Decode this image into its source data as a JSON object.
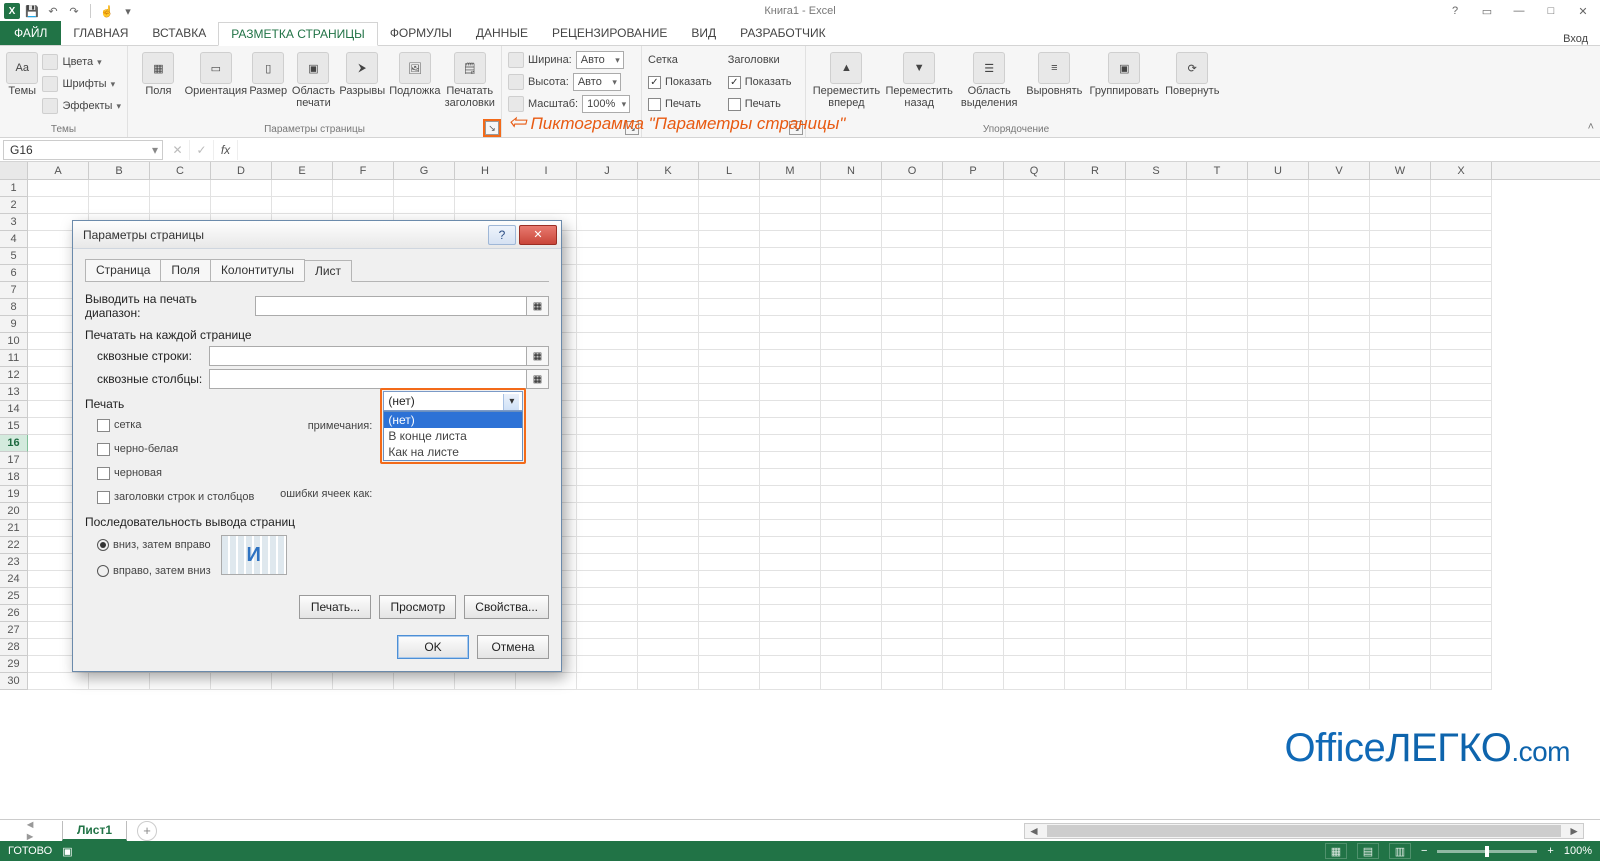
{
  "titlebar": {
    "app_initial": "X",
    "title": "Книга1 - Excel",
    "signin": "Вход",
    "help_window": "?",
    "ribbon_hide": "▭",
    "minimize": "—",
    "maximize": "□",
    "close": "✕"
  },
  "ribbon_tabs": {
    "file": "ФАЙЛ",
    "home": "ГЛАВНАЯ",
    "insert": "ВСТАВКА",
    "page_layout": "РАЗМЕТКА СТРАНИЦЫ",
    "formulas": "ФОРМУЛЫ",
    "data": "ДАННЫЕ",
    "review": "РЕЦЕНЗИРОВАНИЕ",
    "view": "ВИД",
    "developer": "РАЗРАБОТЧИК"
  },
  "ribbon": {
    "themes": {
      "themes_btn": "Темы",
      "colors": "Цвета",
      "fonts": "Шрифты",
      "effects": "Эффекты",
      "group_label": "Темы"
    },
    "page_setup": {
      "margins": "Поля",
      "orientation": "Ориентация",
      "size": "Размер",
      "print_area": "Область печати",
      "breaks": "Разрывы",
      "background": "Подложка",
      "print_titles": "Печатать заголовки",
      "group_label": "Параметры страницы"
    },
    "scale": {
      "width_lbl": "Ширина:",
      "width_val": "Авто",
      "height_lbl": "Высота:",
      "height_val": "Авто",
      "scale_lbl": "Масштаб:",
      "scale_val": "100%"
    },
    "gridlines": {
      "title": "Сетка",
      "show": "Показать",
      "print": "Печать"
    },
    "headings": {
      "title": "Заголовки",
      "show": "Показать",
      "print": "Печать"
    },
    "arrange": {
      "fwd": "Переместить вперед",
      "back": "Переместить назад",
      "selpane": "Область выделения",
      "align": "Выровнять",
      "group": "Группировать",
      "rotate": "Повернуть",
      "group_label": "Упорядочение"
    }
  },
  "annotation": "Пиктограмма \"Параметры страницы\"",
  "formula_bar": {
    "namebox": "G16",
    "fx": "fx"
  },
  "columns": [
    "A",
    "B",
    "C",
    "D",
    "E",
    "F",
    "G",
    "H",
    "I",
    "J",
    "K",
    "L",
    "M",
    "N",
    "O",
    "P",
    "Q",
    "R",
    "S",
    "T",
    "U",
    "V",
    "W",
    "X"
  ],
  "dialog": {
    "title": "Параметры страницы",
    "tabs": {
      "page": "Страница",
      "margins": "Поля",
      "headerfooter": "Колонтитулы",
      "sheet": "Лист"
    },
    "print_area_lbl": "Выводить на печать диапазон:",
    "print_titles_lbl": "Печатать на каждой странице",
    "rows_repeat_lbl": "сквозные строки:",
    "cols_repeat_lbl": "сквозные столбцы:",
    "print_section": "Печать",
    "gridlines": "сетка",
    "bw": "черно-белая",
    "draft": "черновая",
    "rowcolhead": "заголовки строк и столбцов",
    "comments_lbl": "примечания:",
    "errors_lbl": "ошибки ячеек как:",
    "comments_value": "(нет)",
    "comments_options": [
      "(нет)",
      "В конце листа",
      "Как на листе"
    ],
    "order_section": "Последовательность вывода страниц",
    "order_down": "вниз, затем вправо",
    "order_over": "вправо, затем вниз",
    "btn_print": "Печать...",
    "btn_preview": "Просмотр",
    "btn_options": "Свойства...",
    "btn_ok": "OK",
    "btn_cancel": "Отмена"
  },
  "sheet_tabs": {
    "sheet1": "Лист1",
    "add": "+"
  },
  "status": {
    "ready": "ГОТОВО",
    "zoom": "100%"
  },
  "watermark": {
    "a": "Office",
    "b": "ЛЕГКО",
    "c": ".com"
  }
}
